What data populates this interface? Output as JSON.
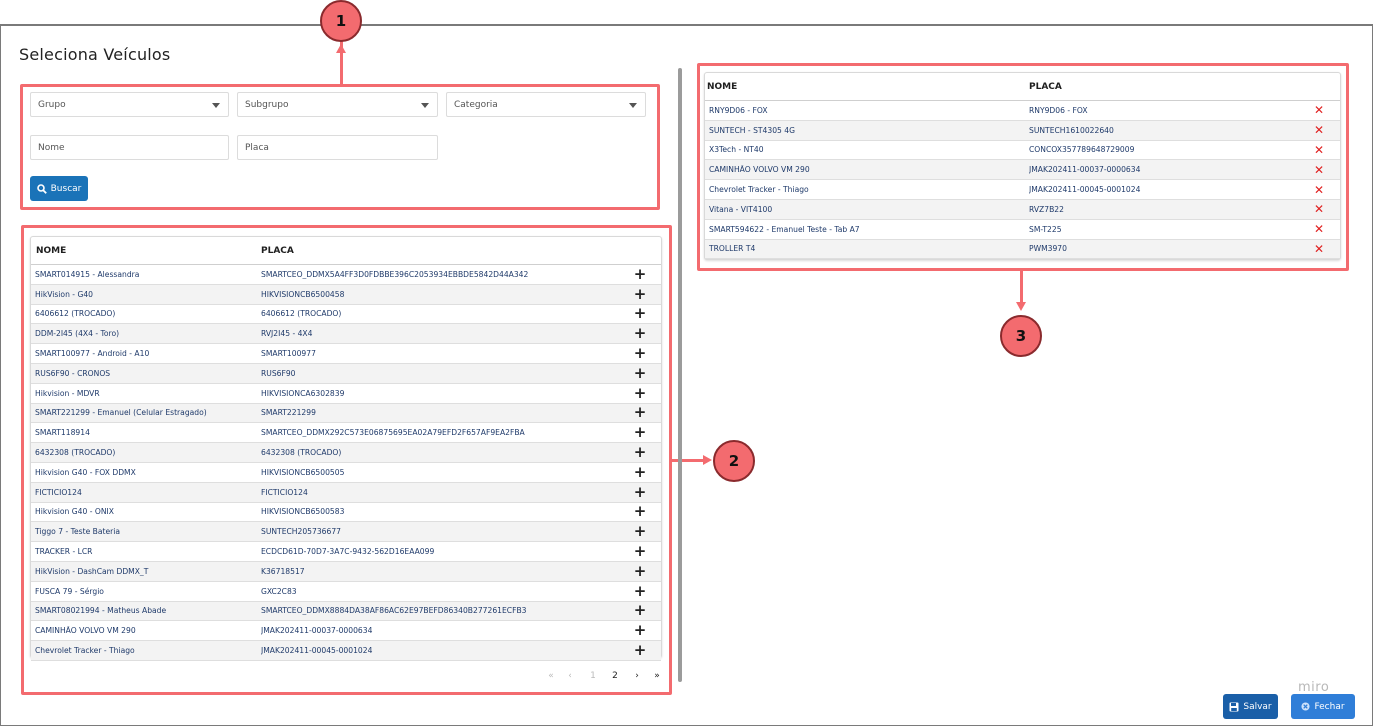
{
  "dialog": {
    "title": "Seleciona Veículos"
  },
  "filters": {
    "grupo_placeholder": "Grupo",
    "subgrupo_placeholder": "Subgrupo",
    "categoria_placeholder": "Categoria",
    "nome_placeholder": "Nome",
    "placa_placeholder": "Placa",
    "buscar_label": "Buscar"
  },
  "available": {
    "headers": {
      "nome": "NOME",
      "placa": "PLACA"
    },
    "rows": [
      {
        "nome": "SMART014915 - Alessandra",
        "placa": "SMARTCEO_DDMX5A4FF3D0FDBBE396C2053934EBBDE5842D44A342"
      },
      {
        "nome": "HikVision - G40",
        "placa": "HIKVISIONCB6500458"
      },
      {
        "nome": "6406612 (TROCADO)",
        "placa": "6406612 (TROCADO)"
      },
      {
        "nome": "DDM-2I45 (4X4 - Toro)",
        "placa": "RVJ2I45 - 4X4"
      },
      {
        "nome": "SMART100977 - Android - A10",
        "placa": "SMART100977"
      },
      {
        "nome": "RUS6F90 - CRONOS",
        "placa": "RUS6F90"
      },
      {
        "nome": "Hikvision - MDVR",
        "placa": "HIKVISIONCA6302839"
      },
      {
        "nome": "SMART221299 - Emanuel (Celular Estragado)",
        "placa": "SMART221299"
      },
      {
        "nome": "SMART118914",
        "placa": "SMARTCEO_DDMX292C573E06875695EA02A79EFD2F657AF9EA2FBA"
      },
      {
        "nome": "6432308 (TROCADO)",
        "placa": "6432308 (TROCADO)"
      },
      {
        "nome": "Hikvision G40 - FOX DDMX",
        "placa": "HIKVISIONCB6500505"
      },
      {
        "nome": "FICTICIO124",
        "placa": "FICTICIO124"
      },
      {
        "nome": "Hikvision G40 - ONIX",
        "placa": "HIKVISIONCB6500583"
      },
      {
        "nome": "Tiggo 7 - Teste Bateria",
        "placa": "SUNTECH205736677"
      },
      {
        "nome": "TRACKER - LCR",
        "placa": "ECDCD61D-70D7-3A7C-9432-562D16EAA099"
      },
      {
        "nome": "HikVision - DashCam DDMX_T",
        "placa": "K36718517"
      },
      {
        "nome": "FUSCA 79 - Sérgio",
        "placa": "GXC2C83"
      },
      {
        "nome": "SMART08021994 - Matheus Abade",
        "placa": "SMARTCEO_DDMX8884DA38AF86AC62E97BEFD86340B277261ECFB3"
      },
      {
        "nome": "CAMINHÃO VOLVO VM 290",
        "placa": "JMAK202411-00037-0000634"
      },
      {
        "nome": "Chevrolet Tracker - Thiago",
        "placa": "JMAK202411-00045-0001024"
      }
    ],
    "add_icon": "plus-icon"
  },
  "pagination": {
    "first": "«",
    "prev": "‹",
    "page1": "1",
    "page2": "2",
    "next": "›",
    "last": "»",
    "current": 2
  },
  "selected": {
    "headers": {
      "nome": "NOME",
      "placa": "PLACA"
    },
    "rows": [
      {
        "nome": "RNY9D06 - FOX",
        "placa": "RNY9D06 - FOX"
      },
      {
        "nome": "SUNTECH - ST4305 4G",
        "placa": "SUNTECH1610022640"
      },
      {
        "nome": "X3Tech - NT40",
        "placa": "CONCOX357789648729009"
      },
      {
        "nome": "CAMINHÃO VOLVO VM 290",
        "placa": "JMAK202411-00037-0000634"
      },
      {
        "nome": "Chevrolet Tracker - Thiago",
        "placa": "JMAK202411-00045-0001024"
      },
      {
        "nome": "Vitana - VIT4100",
        "placa": "RVZ7B22"
      },
      {
        "nome": "SMART594622 - Emanuel Teste - Tab A7",
        "placa": "SM-T225"
      },
      {
        "nome": "TROLLER T4",
        "placa": "PWM3970"
      }
    ],
    "remove_icon": "remove-x-icon"
  },
  "annotations": {
    "badge1": "1",
    "badge2": "2",
    "badge3": "3",
    "color": "#f36b6f"
  },
  "footer": {
    "salvar_label": "Salvar",
    "fechar_label": "Fechar",
    "watermark": "miro"
  }
}
